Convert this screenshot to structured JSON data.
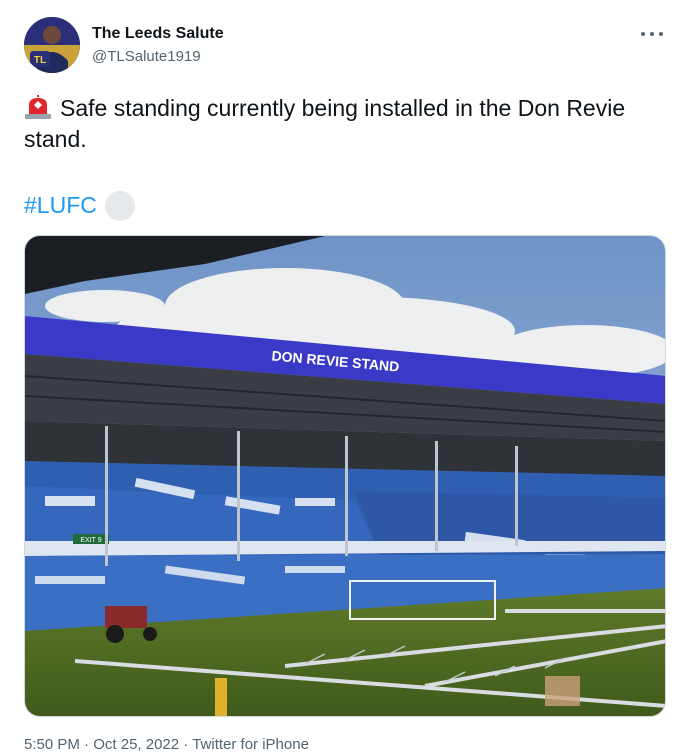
{
  "author": {
    "name": "The Leeds Salute",
    "handle": "@TLSalute1919",
    "avatar_badge": "TL"
  },
  "tweet": {
    "text": "Safe standing currently being installed in the Don Revie stand.",
    "hashtag": "#LUFC",
    "emoji_icon": "rotating-light-icon"
  },
  "media": {
    "stand_sign": "DON REVIE STAND",
    "exit_sign": "EXIT 9"
  },
  "meta": {
    "time": "5:50 PM",
    "date": "Oct 25, 2022",
    "source": "Twitter for iPhone",
    "separator": "·"
  },
  "colors": {
    "link": "#1d9bf0",
    "secondary_text": "#536471",
    "stand_roof_band": "#3a39c8"
  }
}
